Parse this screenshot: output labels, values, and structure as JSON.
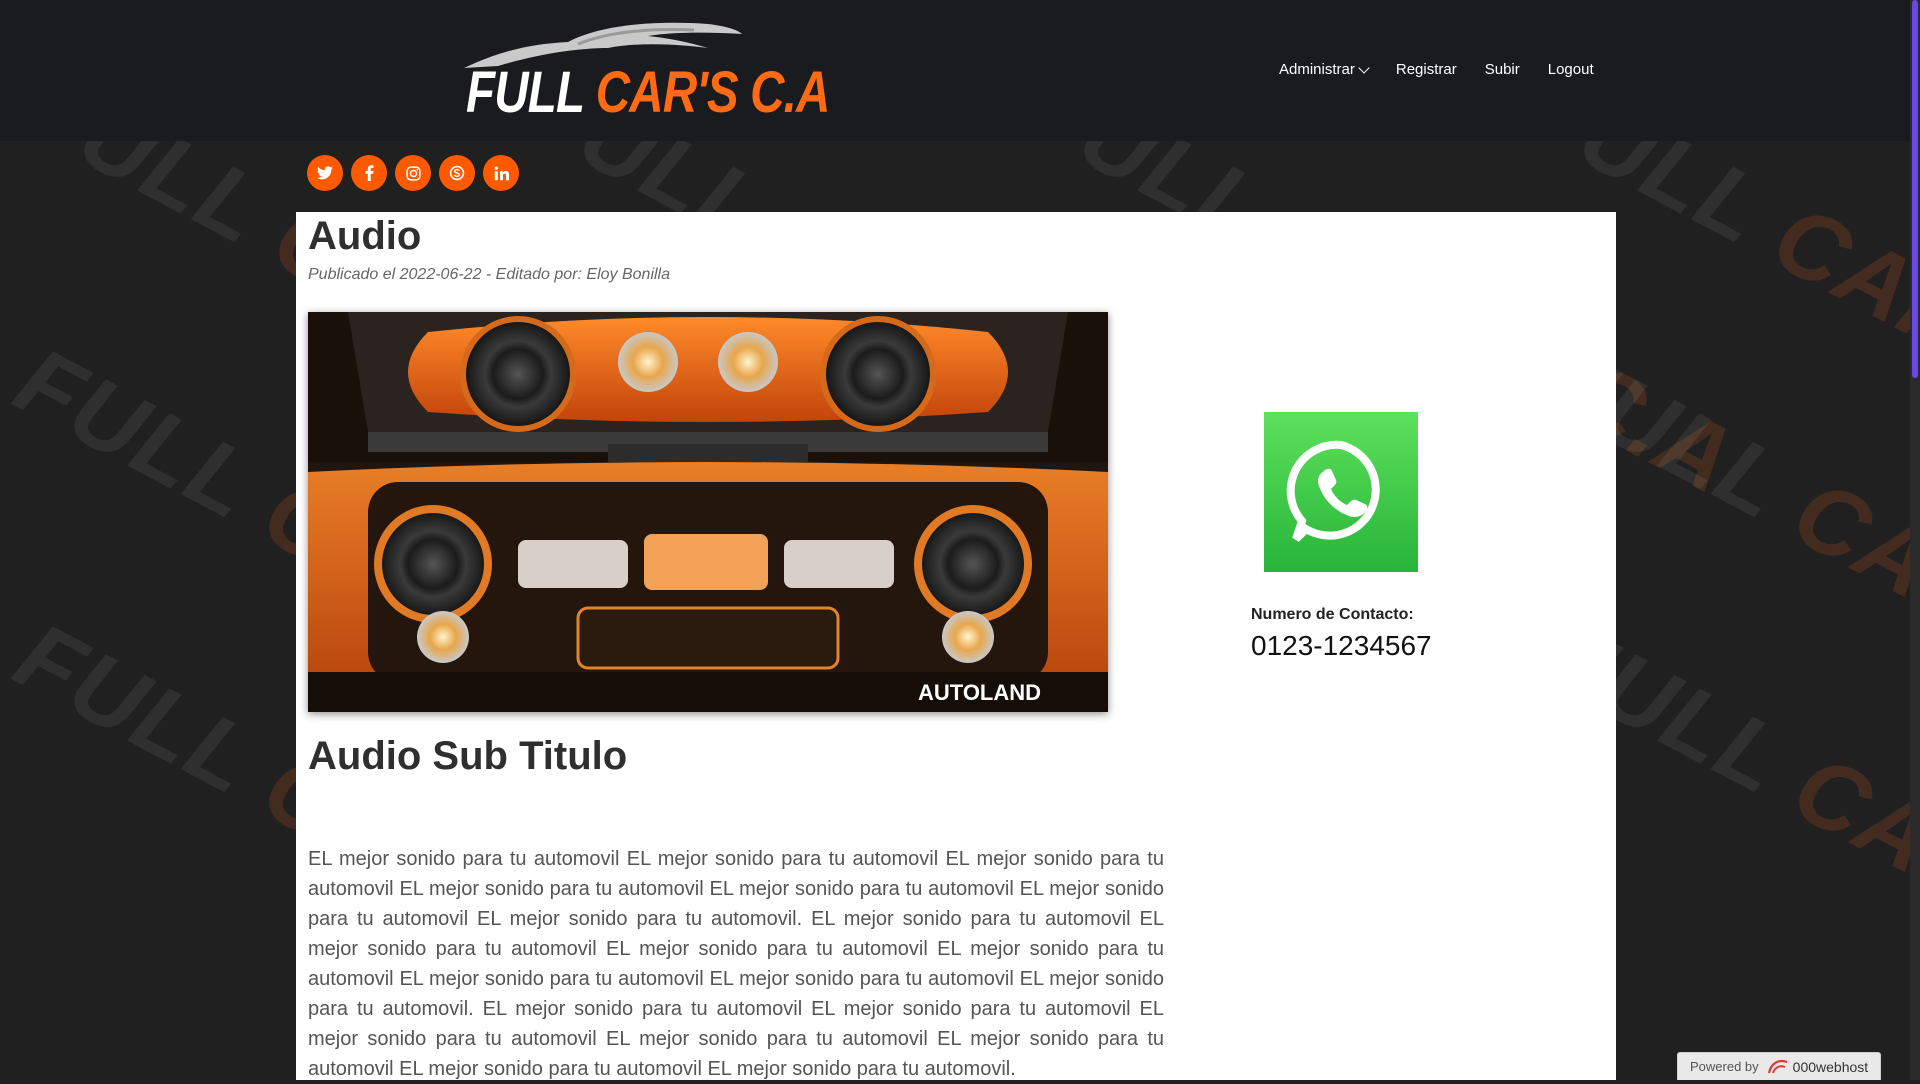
{
  "brand": {
    "name_white": "FULL ",
    "name_orange": "CAR'S C.A",
    "orange": "#ff6a12"
  },
  "nav": {
    "items": [
      {
        "label": "Administrar",
        "has_dropdown": true
      },
      {
        "label": "Registrar"
      },
      {
        "label": "Subir"
      },
      {
        "label": "Logout"
      }
    ]
  },
  "social": [
    "twitter-icon",
    "facebook-icon",
    "instagram-icon",
    "skype-icon",
    "linkedin-icon"
  ],
  "watermark": {
    "text_white": "FULL ",
    "text_orange": "CAR'S C.A"
  },
  "article": {
    "title": "Audio",
    "meta": "Publicado el 2022-06-22 - Editado por: Eloy Bonilla",
    "image_caption": "AUTOLAND",
    "subtitle": "Audio Sub Titulo",
    "body": "EL mejor sonido para tu automovil EL mejor sonido para tu automovil EL mejor sonido para tu automovil EL mejor sonido para tu automovil EL mejor sonido para tu automovil EL mejor sonido para tu automovil EL mejor sonido para tu automovil. EL mejor sonido para tu automovil EL mejor sonido para tu automovil EL mejor sonido para tu automovil EL mejor sonido para tu automovil EL mejor sonido para tu automovil EL mejor sonido para tu automovil EL mejor sonido para tu automovil. EL mejor sonido para tu automovil EL mejor sonido para tu automovil EL mejor sonido para tu automovil EL mejor sonido para tu automovil EL mejor sonido para tu automovil EL mejor sonido para tu automovil EL mejor sonido para tu automovil."
  },
  "contact": {
    "label": "Numero de Contacto:",
    "number": "0123-1234567"
  },
  "footer": {
    "powered_label": "Powered by",
    "powered_brand": "000webhost"
  }
}
